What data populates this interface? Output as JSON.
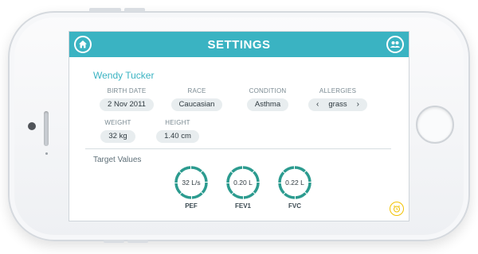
{
  "header": {
    "title": "SETTINGS"
  },
  "patient": {
    "name": "Wendy Tucker"
  },
  "fields": {
    "birth_date": {
      "label": "BIRTH DATE",
      "value": "2 Nov 2011"
    },
    "race": {
      "label": "RACE",
      "value": "Caucasian"
    },
    "condition": {
      "label": "CONDITION",
      "value": "Asthma"
    },
    "allergies": {
      "label": "ALLERGIES",
      "value": "grass",
      "prev": "‹",
      "next": "›"
    },
    "weight": {
      "label": "WEIGHT",
      "value": "32 kg"
    },
    "height": {
      "label": "HEIGHT",
      "value": "1.40 cm"
    }
  },
  "target_values": {
    "label": "Target Values",
    "gauges": [
      {
        "label": "PEF",
        "value": "32 L/s"
      },
      {
        "label": "FEV1",
        "value": "0.20 L"
      },
      {
        "label": "FVC",
        "value": "0.22 L"
      }
    ]
  },
  "colors": {
    "accent": "#3ab3c2",
    "gauge_ring": "#2c9b8f",
    "alarm": "#f2c200"
  },
  "icons": {
    "home": "home-icon",
    "users": "users-icon",
    "alarm": "alarm-clock-icon"
  }
}
